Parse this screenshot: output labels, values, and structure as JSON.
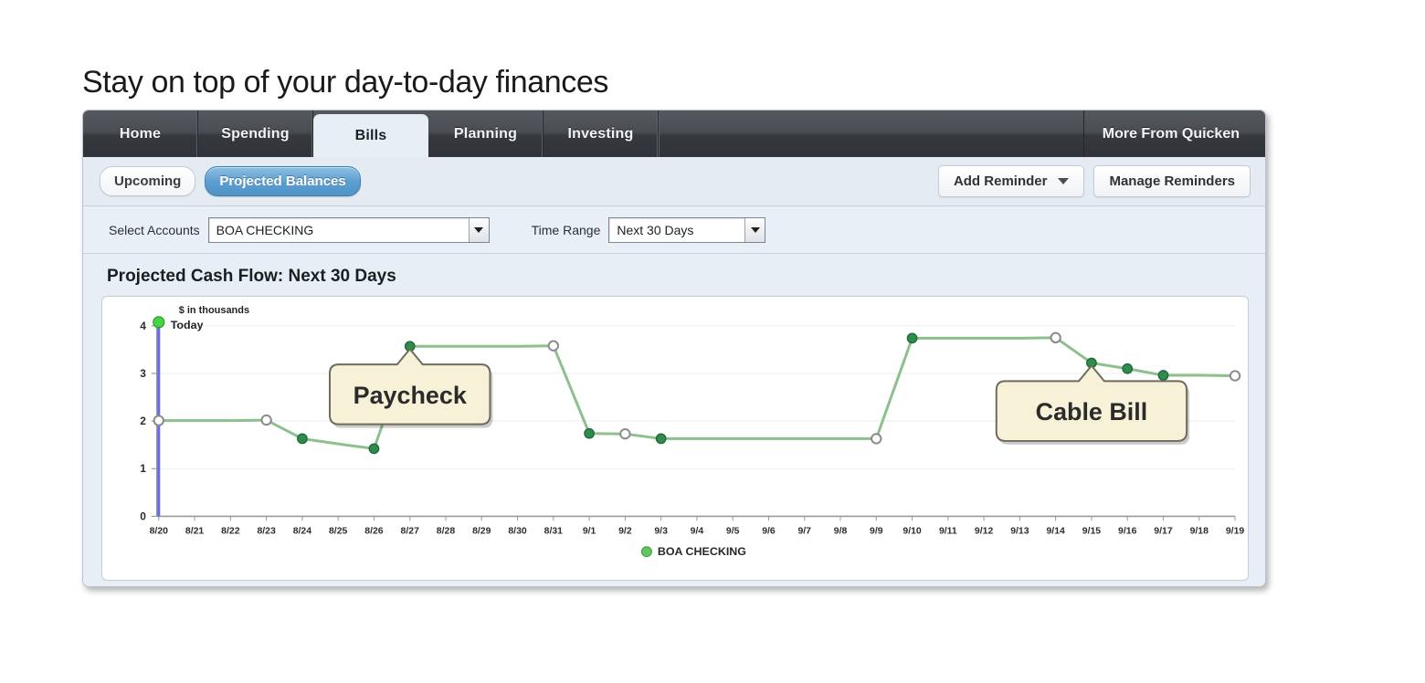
{
  "headline": "Stay on top of your day-to-day finances",
  "nav": {
    "tabs": [
      {
        "label": "Home",
        "active": false
      },
      {
        "label": "Spending",
        "active": false
      },
      {
        "label": "Bills",
        "active": true
      },
      {
        "label": "Planning",
        "active": false
      },
      {
        "label": "Investing",
        "active": false
      }
    ],
    "more_label": "More From Quicken"
  },
  "toolbar": {
    "upcoming_label": "Upcoming",
    "projected_balances_label": "Projected Balances",
    "add_reminder_label": "Add Reminder",
    "manage_reminders_label": "Manage Reminders"
  },
  "filters": {
    "accounts_label": "Select Accounts",
    "accounts_value": "BOA CHECKING",
    "timerange_label": "Time Range",
    "timerange_value": "Next 30 Days"
  },
  "section": {
    "title": "Projected Cash Flow: Next 30 Days"
  },
  "colors": {
    "accent_blue": "#5e9fd0",
    "nav_dark": "#3a3e43",
    "line_green": "#8cc08c",
    "marker_green": "#2f8c4e",
    "today_green": "#45d545",
    "today_line_blue": "#6a6af0",
    "callout_bg": "#f7f1d7",
    "panel_bg": "#e8eef5"
  },
  "chart_data": {
    "type": "line",
    "title": "Projected Cash Flow: Next 30 Days",
    "unit_label": "$ in thousands",
    "today_label": "Today",
    "today_x": "8/20",
    "xlabel": "",
    "ylabel": "$ in thousands",
    "ylim": [
      0,
      4
    ],
    "yticks": [
      0,
      1,
      2,
      3,
      4
    ],
    "grid": true,
    "legend": {
      "position": "bottom",
      "entries": [
        "BOA CHECKING"
      ]
    },
    "categories": [
      "8/20",
      "8/21",
      "8/22",
      "8/23",
      "8/24",
      "8/25",
      "8/26",
      "8/27",
      "8/28",
      "8/29",
      "8/30",
      "8/31",
      "9/1",
      "9/2",
      "9/3",
      "9/4",
      "9/5",
      "9/6",
      "9/7",
      "9/8",
      "9/9",
      "9/10",
      "9/11",
      "9/12",
      "9/13",
      "9/14",
      "9/15",
      "9/16",
      "9/17",
      "9/18",
      "9/19"
    ],
    "series": [
      {
        "name": "BOA CHECKING",
        "color": "#8cc08c",
        "values": [
          2.01,
          2.01,
          2.01,
          2.02,
          1.63,
          1.52,
          1.42,
          3.57,
          3.57,
          3.57,
          3.57,
          3.58,
          1.74,
          1.73,
          1.63,
          1.63,
          1.63,
          1.63,
          1.63,
          1.63,
          1.63,
          3.74,
          3.74,
          3.74,
          3.74,
          3.75,
          3.22,
          3.1,
          2.96,
          2.96,
          2.95
        ],
        "markers": [
          "hollow",
          "none",
          "none",
          "hollow",
          "filled",
          "none",
          "filled",
          "filled",
          "none",
          "none",
          "none",
          "hollow",
          "filled",
          "hollow",
          "filled",
          "none",
          "none",
          "none",
          "none",
          "none",
          "hollow",
          "filled",
          "none",
          "none",
          "none",
          "hollow",
          "filled",
          "filled",
          "filled",
          "none",
          "hollow"
        ]
      }
    ],
    "annotations": [
      {
        "text": "Paycheck",
        "anchor_x": "8/27",
        "anchor_y": 3.57
      },
      {
        "text": "Cable Bill",
        "anchor_x": "9/15",
        "anchor_y": 3.22
      }
    ]
  }
}
